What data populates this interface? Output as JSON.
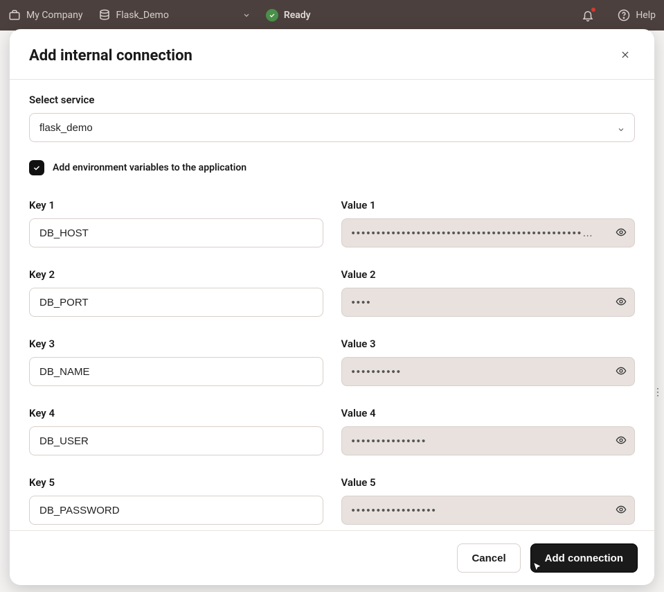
{
  "topbar": {
    "company": "My Company",
    "project": "Flask_Demo",
    "status": "Ready",
    "help": "Help"
  },
  "modal": {
    "title": "Add internal connection",
    "select_label": "Select service",
    "select_value": "flask_demo",
    "checkbox_label": "Add environment variables to the application",
    "checkbox_checked": true,
    "rows": [
      {
        "key_label": "Key 1",
        "value_label": "Value 1",
        "key": "DB_HOST",
        "value_masked": "••••••••••••••••••••••••••••••••••••••••••••••…"
      },
      {
        "key_label": "Key 2",
        "value_label": "Value 2",
        "key": "DB_PORT",
        "value_masked": "••••"
      },
      {
        "key_label": "Key 3",
        "value_label": "Value 3",
        "key": "DB_NAME",
        "value_masked": "••••••••••"
      },
      {
        "key_label": "Key 4",
        "value_label": "Value 4",
        "key": "DB_USER",
        "value_masked": "•••••••••••••••"
      },
      {
        "key_label": "Key 5",
        "value_label": "Value 5",
        "key": "DB_PASSWORD",
        "value_masked": "•••••••••••••••••"
      }
    ],
    "cancel_label": "Cancel",
    "submit_label": "Add connection"
  }
}
